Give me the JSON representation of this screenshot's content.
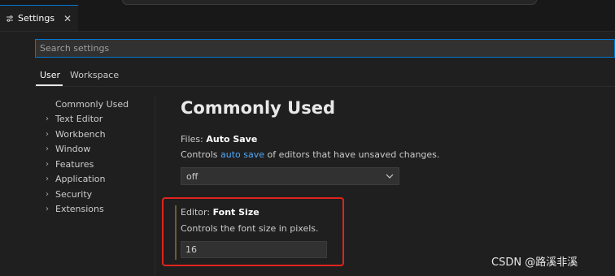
{
  "tab": {
    "icon": "settings-sliders-icon",
    "label": "Settings",
    "close_icon": "close-icon",
    "close_glyph": "✕"
  },
  "search": {
    "placeholder": "Search settings",
    "value": ""
  },
  "scopes": {
    "user": "User",
    "workspace": "Workspace",
    "active": "User"
  },
  "toc": {
    "items": [
      {
        "label": "Commonly Used",
        "expandable": false
      },
      {
        "label": "Text Editor",
        "expandable": true
      },
      {
        "label": "Workbench",
        "expandable": true
      },
      {
        "label": "Window",
        "expandable": true
      },
      {
        "label": "Features",
        "expandable": true
      },
      {
        "label": "Application",
        "expandable": true
      },
      {
        "label": "Security",
        "expandable": true
      },
      {
        "label": "Extensions",
        "expandable": true
      }
    ]
  },
  "content": {
    "section_title": "Commonly Used",
    "auto_save": {
      "category": "Files: ",
      "name": "Auto Save",
      "desc_prefix": "Controls ",
      "desc_link": "auto save",
      "desc_suffix": " of editors that have unsaved changes.",
      "value": "off"
    },
    "font_size": {
      "category": "Editor: ",
      "name": "Font Size",
      "desc": "Controls the font size in pixels.",
      "value": "16"
    }
  },
  "colors": {
    "accent": "#0078d4",
    "link": "#4daafc",
    "highlight": "#e0241c",
    "background": "#1f1f1f"
  },
  "watermark": "CSDN @路溪非溪"
}
